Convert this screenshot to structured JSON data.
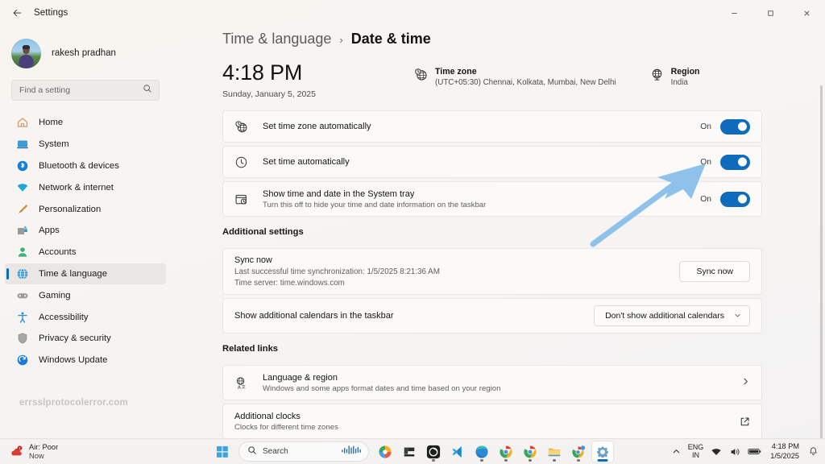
{
  "window": {
    "title": "Settings",
    "back_icon": "back-arrow-icon",
    "minimize": "–",
    "maximize": "❐",
    "close": "✕"
  },
  "sidebar": {
    "account_name": "rakesh pradhan",
    "search": {
      "placeholder": "Find a setting",
      "value": ""
    },
    "items": [
      {
        "label": "Home",
        "icon": "home-icon"
      },
      {
        "label": "System",
        "icon": "system-icon"
      },
      {
        "label": "Bluetooth & devices",
        "icon": "bluetooth-icon"
      },
      {
        "label": "Network & internet",
        "icon": "network-icon"
      },
      {
        "label": "Personalization",
        "icon": "personalization-icon"
      },
      {
        "label": "Apps",
        "icon": "apps-icon"
      },
      {
        "label": "Accounts",
        "icon": "accounts-icon"
      },
      {
        "label": "Time & language",
        "icon": "time-language-icon"
      },
      {
        "label": "Gaming",
        "icon": "gaming-icon"
      },
      {
        "label": "Accessibility",
        "icon": "accessibility-icon"
      },
      {
        "label": "Privacy & security",
        "icon": "privacy-icon"
      },
      {
        "label": "Windows Update",
        "icon": "windows-update-icon"
      }
    ],
    "active_index": 7,
    "watermark": "errsslprotocolerror.com"
  },
  "breadcrumb": {
    "parent": "Time & language",
    "separator": "›",
    "current": "Date & time"
  },
  "clock_display": {
    "time": "4:18 PM",
    "date": "Sunday, January 5, 2025"
  },
  "timezone_info": {
    "icon": "globe-clock-icon",
    "title": "Time zone",
    "value": "(UTC+05:30) Chennai, Kolkata, Mumbai, New Delhi"
  },
  "region_info": {
    "icon": "globe-icon",
    "title": "Region",
    "value": "India"
  },
  "toggle_settings": [
    {
      "icon": "globe-clock-icon",
      "title": "Set time zone automatically",
      "subtitle": "",
      "state_label": "On",
      "state": true
    },
    {
      "icon": "clock-icon",
      "title": "Set time automatically",
      "subtitle": "",
      "state_label": "On",
      "state": true
    },
    {
      "icon": "calendar-clock-icon",
      "title": "Show time and date in the System tray",
      "subtitle": "Turn this off to hide your time and date information on the taskbar",
      "state_label": "On",
      "state": true
    }
  ],
  "additional_settings": {
    "heading": "Additional settings",
    "sync": {
      "title": "Sync now",
      "last_sync": "Last successful time synchronization: 1/5/2025 8:21:36 AM",
      "time_server": "Time server: time.windows.com",
      "button_label": "Sync now"
    },
    "calendars": {
      "label": "Show additional calendars in the taskbar",
      "selected": "Don't show additional calendars",
      "chevron": "⌄"
    }
  },
  "related_links": {
    "heading": "Related links",
    "items": [
      {
        "icon": "language-region-icon",
        "title": "Language & region",
        "subtitle": "Windows and some apps format dates and time based on your region",
        "affordance": "chevron-right-icon",
        "glyph": "›"
      },
      {
        "icon": "",
        "title": "Additional clocks",
        "subtitle": "Clocks for different time zones",
        "affordance": "external-link-icon",
        "glyph": ""
      }
    ]
  },
  "annotation": {
    "type": "arrow",
    "color": "#8fc2ea",
    "points_to": "set-time-automatically-toggle"
  },
  "taskbar": {
    "weather": {
      "icon": "air-quality-icon",
      "line1": "Air: Poor",
      "line2": "Now"
    },
    "start_icon": "windows-start-icon",
    "search": {
      "icon": "search-icon",
      "label": "Search",
      "widget_icon": "audio-waveform-icon"
    },
    "apps": [
      {
        "name": "copilot-icon"
      },
      {
        "name": "file-explorer-icon"
      },
      {
        "name": "media-player-icon"
      },
      {
        "name": "vs-code-icon"
      },
      {
        "name": "edge-icon"
      },
      {
        "name": "chrome-icon"
      },
      {
        "name": "chrome-beta-icon"
      },
      {
        "name": "folder-icon"
      },
      {
        "name": "chrome-canary-icon"
      },
      {
        "name": "settings-icon"
      }
    ],
    "tray": {
      "chevron": "⌃",
      "language_line1": "ENG",
      "language_line2": "IN",
      "wifi_icon": "wifi-icon",
      "volume_icon": "volume-icon",
      "battery_icon": "battery-icon",
      "time": "4:18 PM",
      "date": "1/5/2025",
      "notification_icon": "bell-icon"
    }
  },
  "colors": {
    "accent": "#0f6cbd",
    "arrow": "#8fc2ea",
    "background": "#f7f4f1",
    "card": "#fbfaf9"
  }
}
